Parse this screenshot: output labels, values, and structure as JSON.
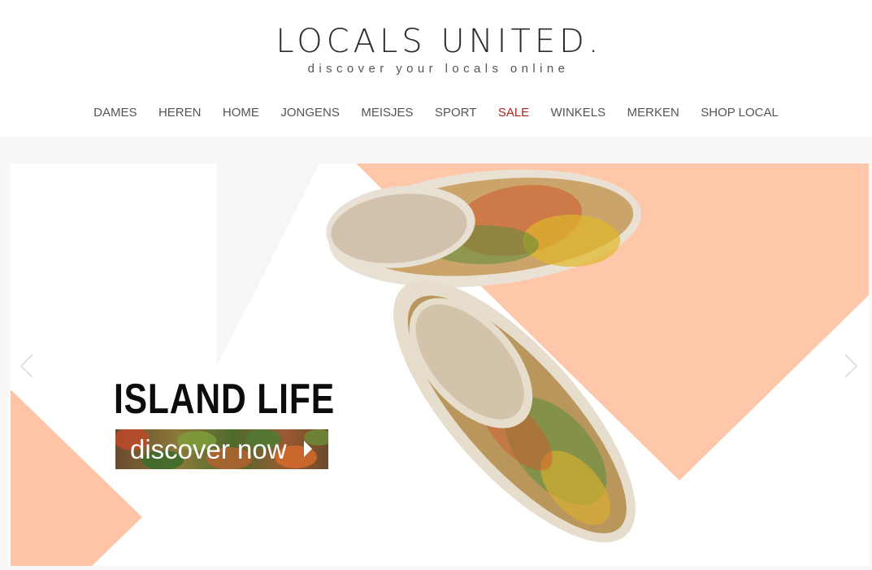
{
  "logo": {
    "title": "LOCALS UNITED.",
    "tagline": "discover your locals online"
  },
  "nav": {
    "items": [
      {
        "label": "DAMES"
      },
      {
        "label": "HEREN"
      },
      {
        "label": "HOME"
      },
      {
        "label": "JONGENS"
      },
      {
        "label": "MEISJES"
      },
      {
        "label": "SPORT"
      },
      {
        "label": "SALE"
      },
      {
        "label": "WINKELS"
      },
      {
        "label": "MERKEN"
      },
      {
        "label": "SHOP LOCAL"
      }
    ]
  },
  "banner": {
    "title": "ISLAND LIFE",
    "cta_label": "discover now",
    "prev_icon": "chevron-left-icon",
    "next_icon": "chevron-right-icon"
  },
  "colors": {
    "text": "#555555",
    "sale": "#b0211d",
    "peach": "#ffc4a6",
    "logo": "#2b2b2b"
  }
}
